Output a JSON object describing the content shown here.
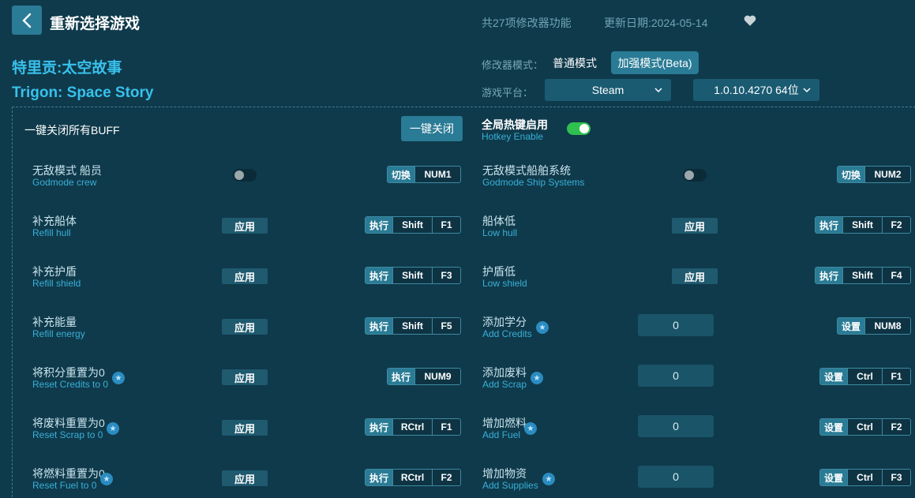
{
  "header": {
    "back_title": "重新选择游戏",
    "feature_count": "共27项修改器功能",
    "update_date": "更新日期:2024-05-14"
  },
  "game": {
    "title_cn": "特里贡:太空故事",
    "title_en": "Trigon: Space Story"
  },
  "mode": {
    "label": "修改器模式：",
    "normal": "普通模式",
    "enhanced": "加强模式(Beta)",
    "selected": "加强模式(Beta)"
  },
  "platform": {
    "label": "游戏平台：",
    "value": "Steam",
    "version": "1.0.10.4270 64位"
  },
  "global": {
    "buff_label": "一键关闭所有BUFF",
    "close_all": "一键关闭",
    "hotkey_cn": "全局热键启用",
    "hotkey_en": "Hotkey Enable",
    "hotkey_enabled": true
  },
  "features_left": [
    {
      "cn": "无敌模式 船员",
      "en": "Godmode crew",
      "control": "toggle",
      "action": "切换",
      "keys": [
        "NUM1"
      ]
    },
    {
      "cn": "补充船体",
      "en": "Refill hull",
      "control": "apply",
      "apply_label": "应用",
      "action": "执行",
      "keys": [
        "Shift",
        "F1"
      ]
    },
    {
      "cn": "补充护盾",
      "en": "Refill shield",
      "control": "apply",
      "apply_label": "应用",
      "action": "执行",
      "keys": [
        "Shift",
        "F3"
      ]
    },
    {
      "cn": "补充能量",
      "en": "Refill energy",
      "control": "apply",
      "apply_label": "应用",
      "action": "执行",
      "keys": [
        "Shift",
        "F5"
      ]
    },
    {
      "cn": "将积分重置为0",
      "en": "Reset Credits to 0",
      "star": true,
      "control": "apply",
      "apply_label": "应用",
      "action": "执行",
      "keys": [
        "NUM9"
      ]
    },
    {
      "cn": "将废料重置为0",
      "en": "Reset Scrap to 0",
      "star": true,
      "control": "apply",
      "apply_label": "应用",
      "action": "执行",
      "keys": [
        "RCtrl",
        "F1"
      ]
    },
    {
      "cn": "将燃料重置为0",
      "en": "Reset Fuel to 0",
      "star": true,
      "control": "apply",
      "apply_label": "应用",
      "action": "执行",
      "keys": [
        "RCtrl",
        "F2"
      ]
    }
  ],
  "features_right": [
    {
      "cn": "无敌模式船舶系统",
      "en": "Godmode Ship Systems",
      "control": "toggle",
      "action": "切换",
      "keys": [
        "NUM2"
      ]
    },
    {
      "cn": "船体低",
      "en": "Low hull",
      "control": "apply",
      "apply_label": "应用",
      "action": "执行",
      "keys": [
        "Shift",
        "F2"
      ]
    },
    {
      "cn": "护盾低",
      "en": "Low shield",
      "control": "apply",
      "apply_label": "应用",
      "action": "执行",
      "keys": [
        "Shift",
        "F4"
      ]
    },
    {
      "cn": "添加学分",
      "en": "Add Credits",
      "star": true,
      "control": "input",
      "value": "0",
      "action": "设置",
      "keys": [
        "NUM8"
      ]
    },
    {
      "cn": "添加废料",
      "en": "Add Scrap",
      "star": true,
      "control": "input",
      "value": "0",
      "action": "设置",
      "keys": [
        "Ctrl",
        "F1"
      ]
    },
    {
      "cn": "增加燃料",
      "en": "Add Fuel",
      "star": true,
      "control": "input",
      "value": "0",
      "action": "设置",
      "keys": [
        "Ctrl",
        "F2"
      ]
    },
    {
      "cn": "增加物资",
      "en": "Add Supplies",
      "star": true,
      "control": "input",
      "value": "0",
      "action": "设置",
      "keys": [
        "Ctrl",
        "F3"
      ]
    }
  ]
}
